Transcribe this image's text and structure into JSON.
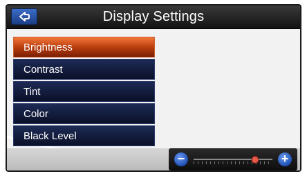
{
  "header": {
    "title": "Display Settings"
  },
  "menu": {
    "items": [
      {
        "label": "Brightness",
        "selected": true
      },
      {
        "label": "Contrast",
        "selected": false
      },
      {
        "label": "Tint",
        "selected": false
      },
      {
        "label": "Color",
        "selected": false
      },
      {
        "label": "Black Level",
        "selected": false
      }
    ]
  },
  "slider": {
    "minus_icon": "minus-icon",
    "plus_icon": "plus-icon",
    "level": 0.78
  },
  "colors": {
    "selected_item": "#c2450f",
    "item": "#0f1836",
    "titlebar": "#1e1e1e",
    "accent_button": "#2b5bb8"
  }
}
